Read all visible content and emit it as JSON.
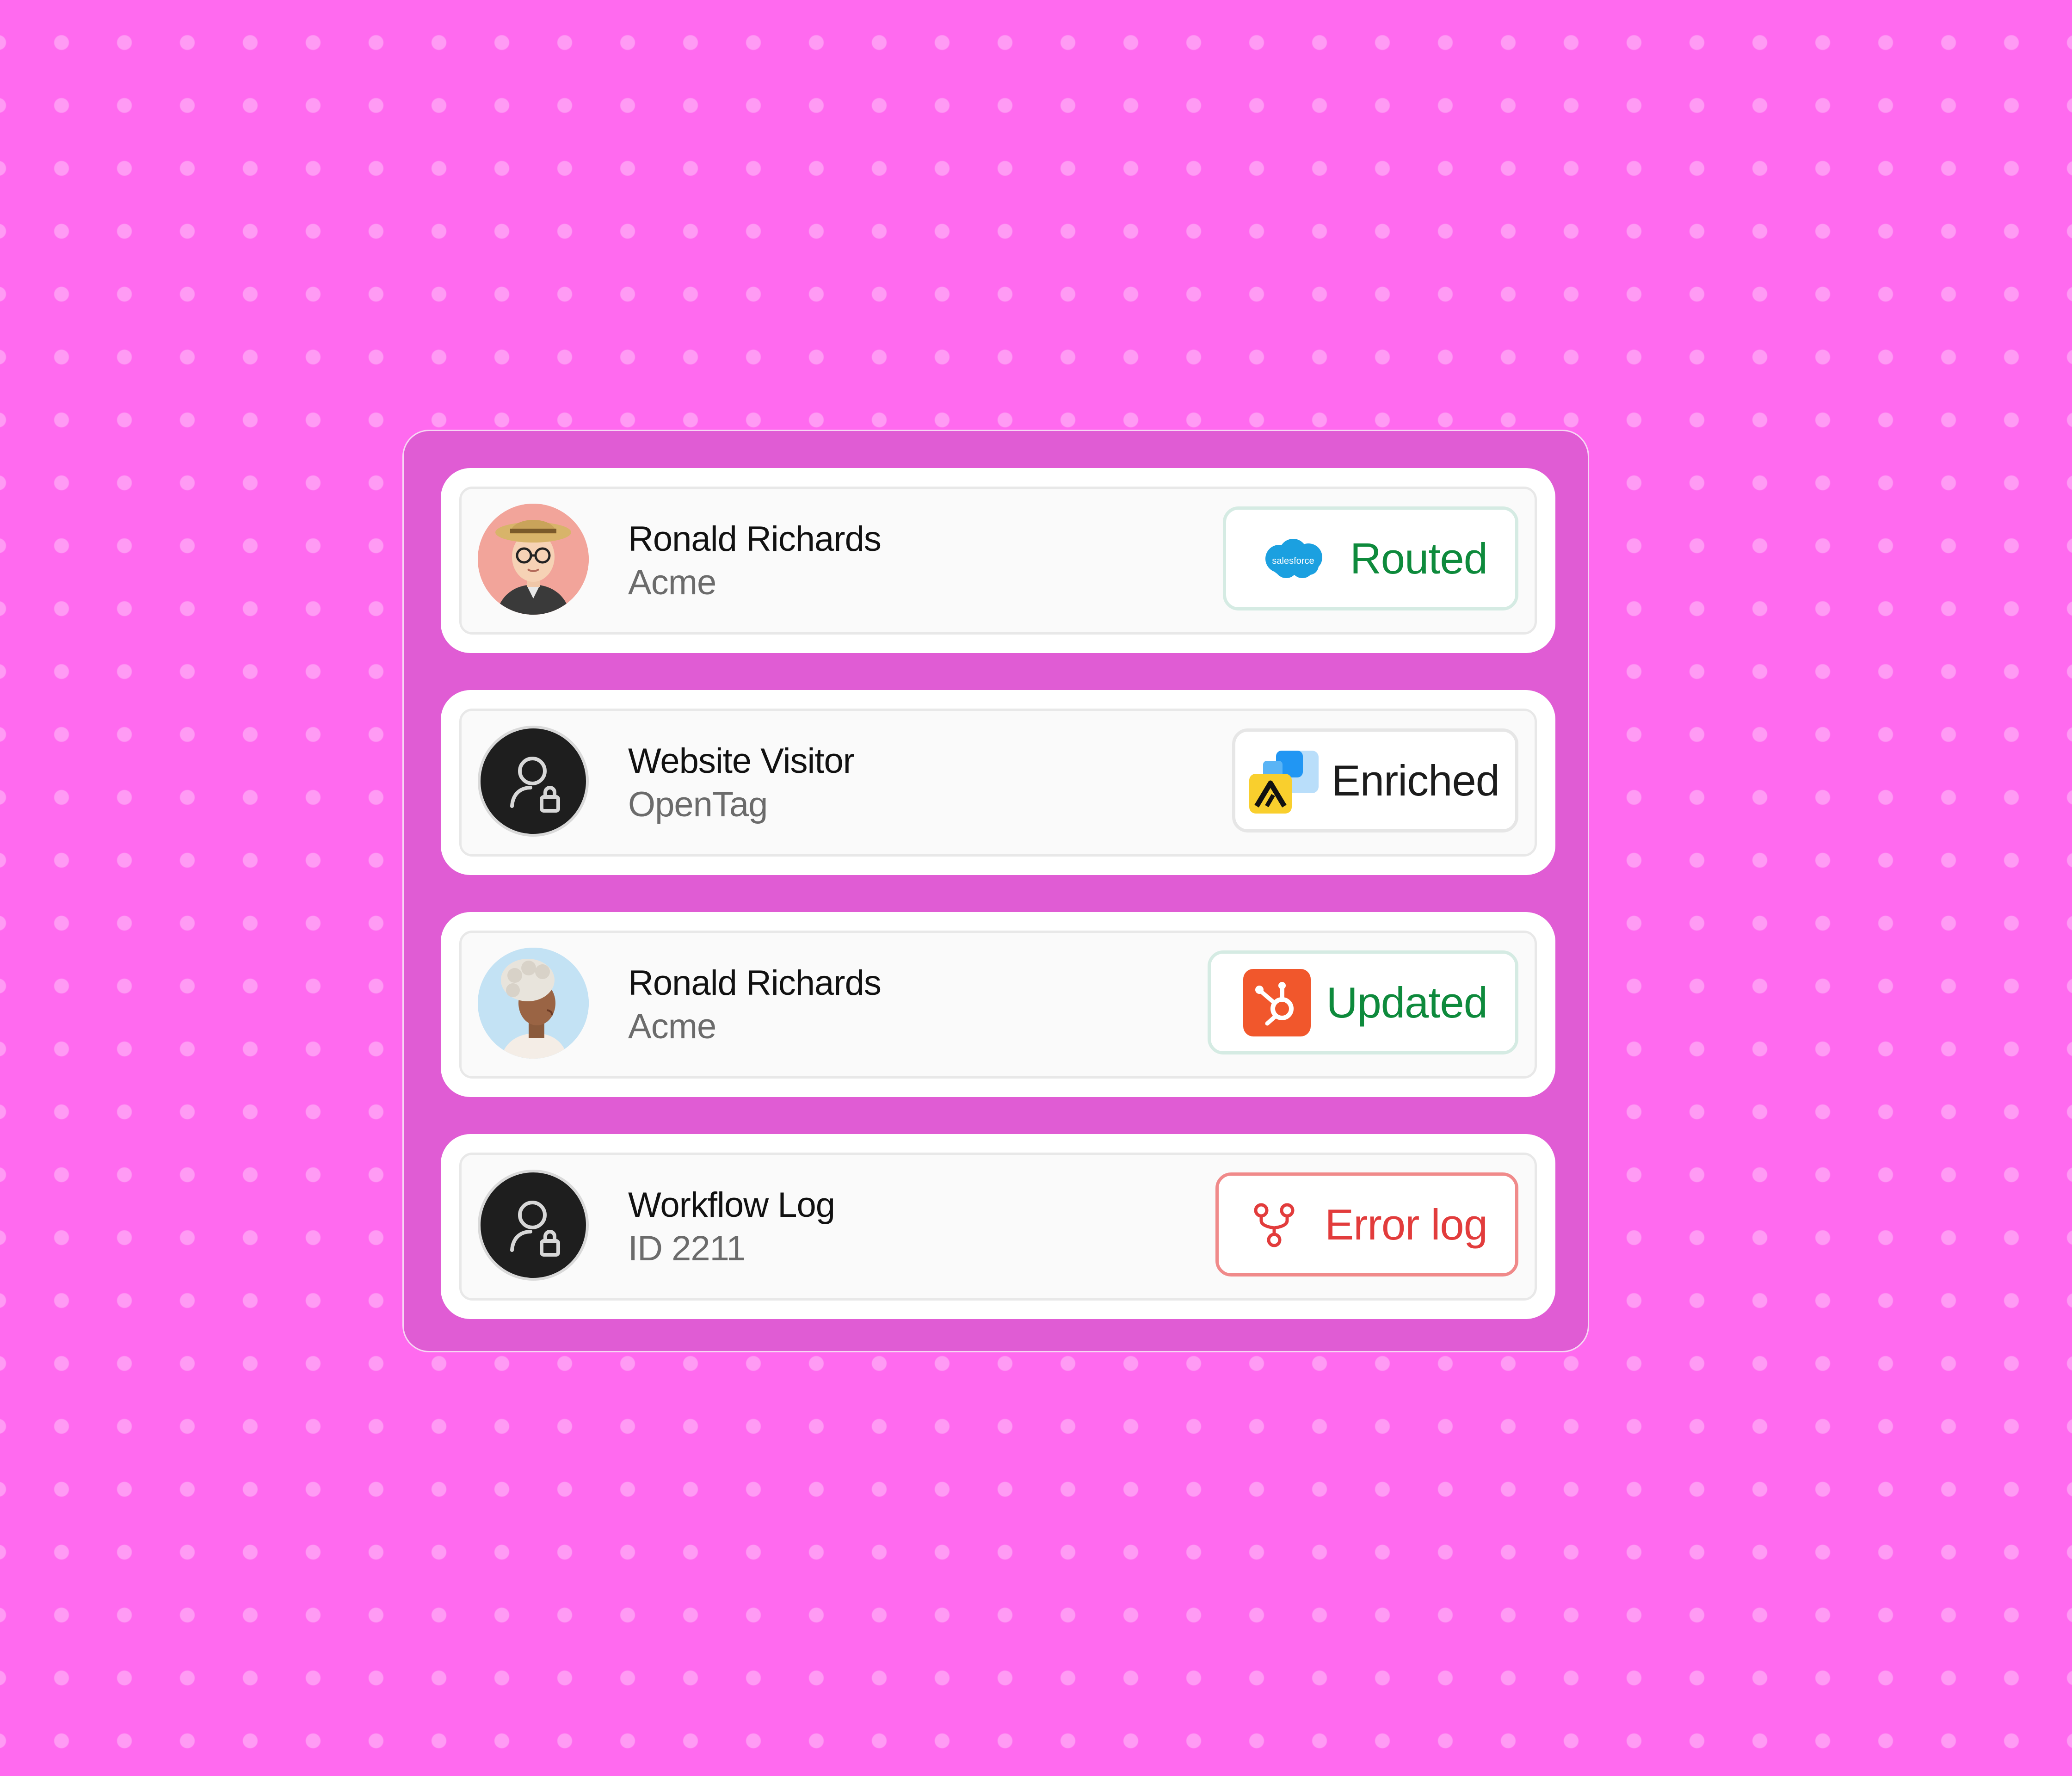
{
  "colors": {
    "background": "#ff6aef",
    "panel": "#e05cd4",
    "status_green": "#0e8a3c",
    "status_red": "#e23c3c",
    "hubspot_orange": "#f1572c",
    "salesforce_blue": "#1ba0e0"
  },
  "activity_feed": {
    "items": [
      {
        "name": "Ronald Richards",
        "subtitle": "Acme",
        "avatar": "person-photo",
        "status": {
          "label": "Routed",
          "icon": "salesforce-logo-icon",
          "icon_text": "salesforce"
        }
      },
      {
        "name": "Website Visitor",
        "subtitle": "OpenTag",
        "avatar": "anonymous-user-lock-icon",
        "status": {
          "label": "Enriched",
          "icon": "enrichment-app-icon"
        }
      },
      {
        "name": "Ronald Richards",
        "subtitle": "Acme",
        "avatar": "person-photo",
        "status": {
          "label": "Updated",
          "icon": "hubspot-logo-icon"
        }
      },
      {
        "name": "Workflow Log",
        "subtitle": "ID 2211",
        "avatar": "anonymous-user-lock-icon",
        "status": {
          "label": "Error log",
          "icon": "workflow-branch-icon"
        }
      }
    ]
  }
}
